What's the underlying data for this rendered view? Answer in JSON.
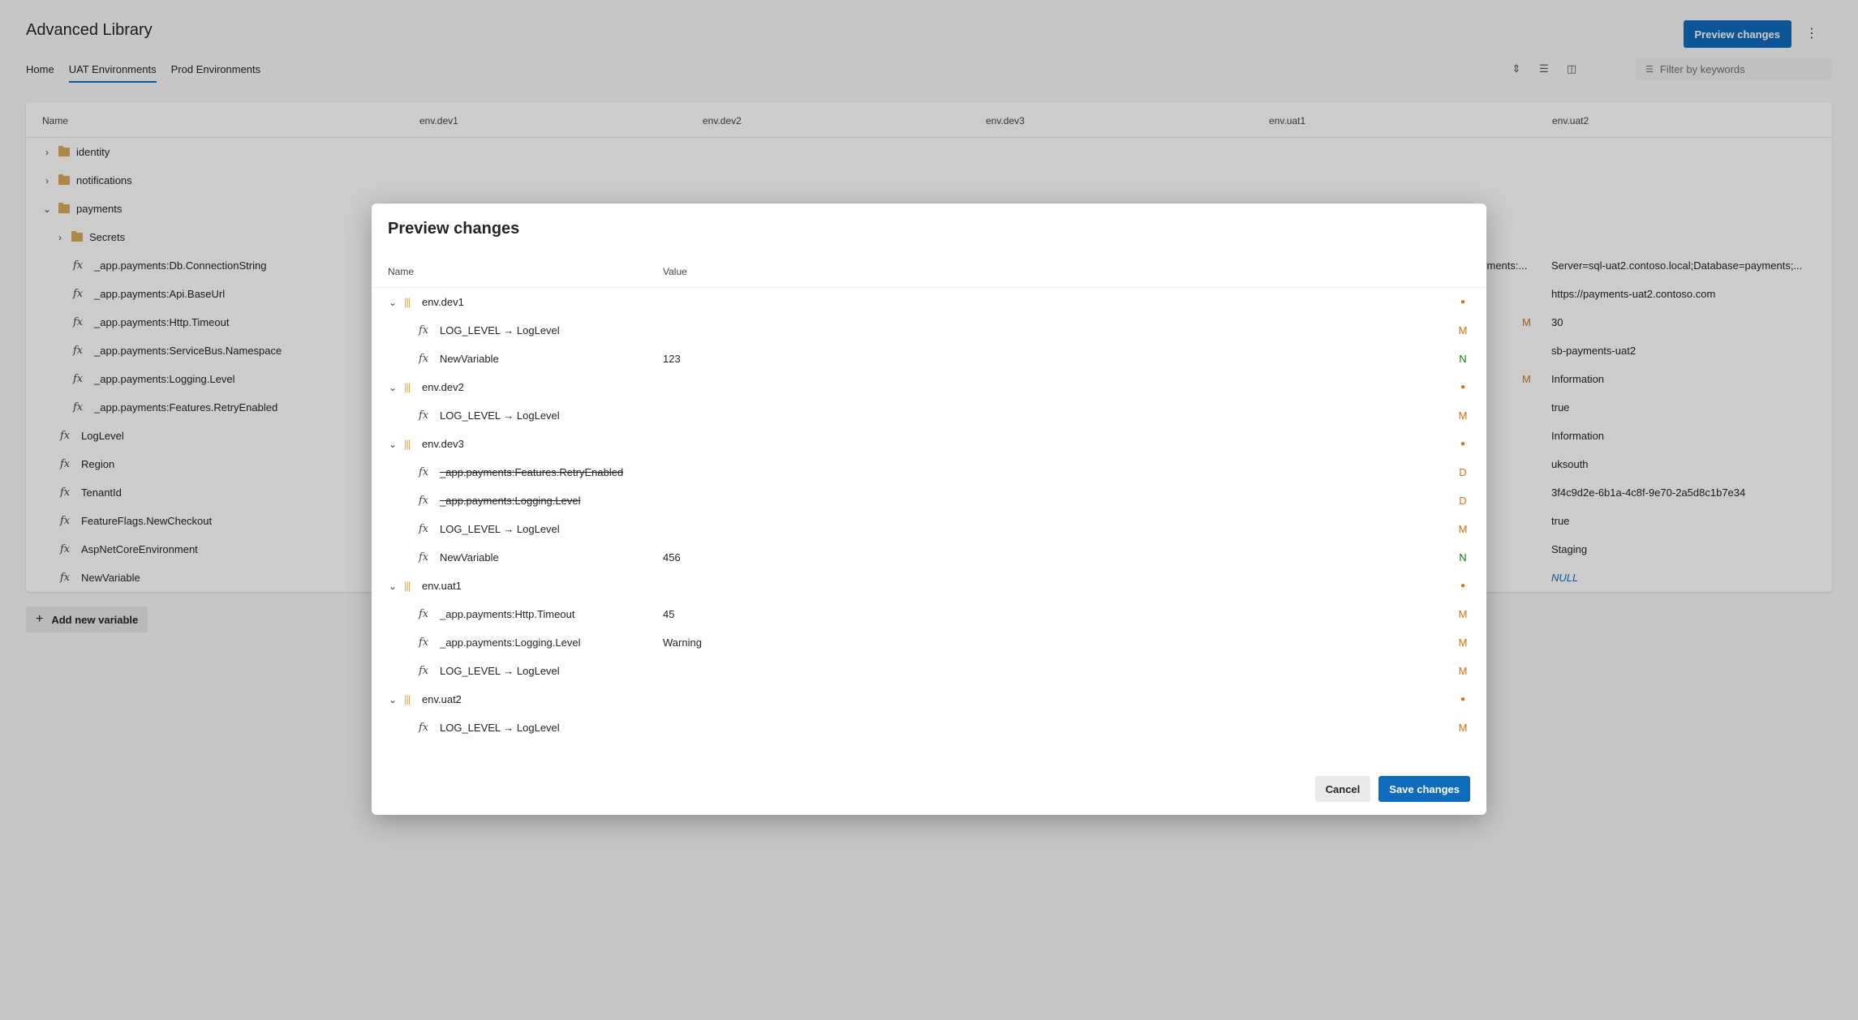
{
  "app": {
    "title": "Advanced Library",
    "preview_button": "Preview changes",
    "more_icon": "more-vertical-icon"
  },
  "tabs": [
    {
      "label": "Home",
      "active": false
    },
    {
      "label": "UAT Environments",
      "active": true
    },
    {
      "label": "Prod Environments",
      "active": false
    }
  ],
  "toolbar": {
    "icons": [
      "expand-collapse-icon",
      "compact-view-icon",
      "split-view-icon"
    ],
    "filter_placeholder": "Filter by keywords"
  },
  "grid": {
    "columns": [
      "Name",
      "env.dev1",
      "env.dev2",
      "env.dev3",
      "env.uat1",
      "env.uat2"
    ],
    "rows": [
      {
        "name": "identity",
        "type": "folder",
        "expanded": false,
        "uat2": ""
      },
      {
        "name": "notifications",
        "type": "folder",
        "expanded": false,
        "uat2": ""
      },
      {
        "name": "payments",
        "type": "folder",
        "expanded": true,
        "uat2": ""
      },
      {
        "name": "Secrets",
        "type": "folder",
        "expanded": false,
        "uat2": ""
      },
      {
        "name": "_app.payments:Db.ConnectionString",
        "type": "variable",
        "uat2": "Server=sql-uat2.contoso.local;Database=payments;...",
        "partial": "yments:..."
      },
      {
        "name": "_app.payments:Api.BaseUrl",
        "type": "variable",
        "uat2": "https://payments-uat2.contoso.com"
      },
      {
        "name": "_app.payments:Http.Timeout",
        "type": "variable",
        "uat2": "30",
        "badge": "M"
      },
      {
        "name": "_app.payments:ServiceBus.Namespace",
        "type": "variable",
        "uat2": "sb-payments-uat2"
      },
      {
        "name": "_app.payments:Logging.Level",
        "type": "variable",
        "uat2": "Information",
        "badge": "M"
      },
      {
        "name": "_app.payments:Features.RetryEnabled",
        "type": "variable",
        "uat2": "true"
      },
      {
        "name": "LogLevel",
        "type": "variable",
        "uat2": "Information"
      },
      {
        "name": "Region",
        "type": "variable",
        "uat2": "uksouth"
      },
      {
        "name": "TenantId",
        "type": "variable",
        "uat2": "3f4c9d2e-6b1a-4c8f-9e70-2a5d8c1b7e34"
      },
      {
        "name": "FeatureFlags.NewCheckout",
        "type": "variable",
        "uat2": "true"
      },
      {
        "name": "AspNetCoreEnvironment",
        "type": "variable",
        "uat2": "Staging"
      },
      {
        "name": "NewVariable",
        "type": "variable",
        "uat2": "NULL"
      }
    ],
    "add_button": "Add new variable"
  },
  "dialog": {
    "title": "Preview changes",
    "col_name": "Name",
    "col_value": "Value",
    "rows": [
      {
        "kind": "env",
        "name": "env.dev1",
        "badge": "●"
      },
      {
        "kind": "var",
        "name": "LOG_LEVEL → LogLevel",
        "value": "",
        "badge": "M"
      },
      {
        "kind": "var",
        "name": "NewVariable",
        "value": "123",
        "badge": "N"
      },
      {
        "kind": "env",
        "name": "env.dev2",
        "badge": "●"
      },
      {
        "kind": "var",
        "name": "LOG_LEVEL → LogLevel",
        "value": "",
        "badge": "M"
      },
      {
        "kind": "env",
        "name": "env.dev3",
        "badge": "●"
      },
      {
        "kind": "var",
        "name": "_app.payments:Features.RetryEnabled",
        "value": "",
        "badge": "D",
        "deleted": true
      },
      {
        "kind": "var",
        "name": "_app.payments:Logging.Level",
        "value": "",
        "badge": "D",
        "deleted": true
      },
      {
        "kind": "var",
        "name": "LOG_LEVEL → LogLevel",
        "value": "",
        "badge": "M"
      },
      {
        "kind": "var",
        "name": "NewVariable",
        "value": "456",
        "badge": "N"
      },
      {
        "kind": "env",
        "name": "env.uat1",
        "badge": "●"
      },
      {
        "kind": "var",
        "name": "_app.payments:Http.Timeout",
        "value": "45",
        "badge": "M"
      },
      {
        "kind": "var",
        "name": "_app.payments:Logging.Level",
        "value": "Warning",
        "badge": "M"
      },
      {
        "kind": "var",
        "name": "LOG_LEVEL → LogLevel",
        "value": "",
        "badge": "M"
      },
      {
        "kind": "env",
        "name": "env.uat2",
        "badge": "●"
      },
      {
        "kind": "var",
        "name": "LOG_LEVEL → LogLevel",
        "value": "",
        "badge": "M"
      }
    ],
    "cancel": "Cancel",
    "save": "Save changes"
  },
  "colors": {
    "accent": "#0f6cbd",
    "modified": "#d4700e",
    "new": "#107c10",
    "folder": "#d6a95c"
  }
}
